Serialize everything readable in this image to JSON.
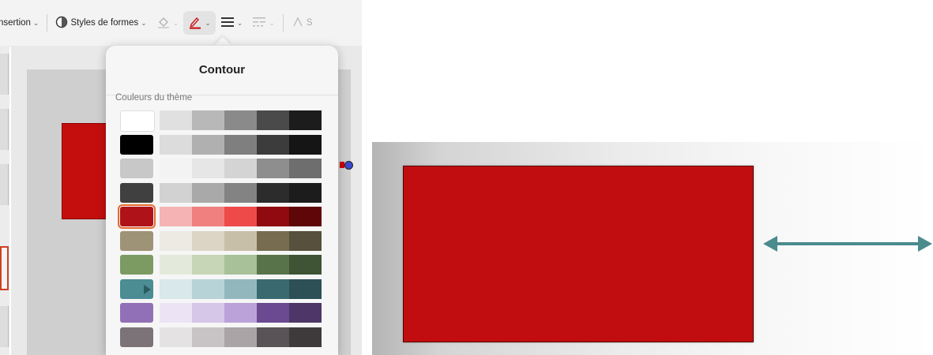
{
  "toolbar": {
    "insertion_label": "nsertion",
    "styles_label": "Styles de formes",
    "truncated_label": "S"
  },
  "popover": {
    "title": "Contour",
    "section_label": "Couleurs du thème",
    "selected_color": "#b0121a"
  },
  "theme_colors": [
    [
      "#ffffff",
      "#e0e0e0",
      "#b8b8b8",
      "#8a8a8a",
      "#4a4a4a",
      "#1c1c1c"
    ],
    [
      "#000000",
      "#dcdcdc",
      "#b0b0b0",
      "#7f7f7f",
      "#3c3c3c",
      "#151515"
    ],
    [
      "#c8c8c8",
      "#f3f3f3",
      "#e6e6e6",
      "#d4d4d4",
      "#8e8e8e",
      "#6e6e6e"
    ],
    [
      "#404040",
      "#d2d2d2",
      "#a9a9a9",
      "#838383",
      "#2c2c2c",
      "#1c1c1c"
    ],
    [
      "#b0121a",
      "#f6b3b3",
      "#f08080",
      "#ef4a4a",
      "#900a0f",
      "#5e0608"
    ],
    [
      "#9e9376",
      "#edeae4",
      "#dcd5c6",
      "#c8bfa8",
      "#786c50",
      "#56503c"
    ],
    [
      "#7b9b63",
      "#e3eadc",
      "#c6d6b7",
      "#a8c198",
      "#58734a",
      "#3e5434"
    ],
    [
      "#4c8c93",
      "#d9e8ea",
      "#b7d3d7",
      "#92b8bd",
      "#3a6a70",
      "#2c5055"
    ],
    [
      "#9270b7",
      "#ece4f4",
      "#d6c6e8",
      "#bba3d9",
      "#6c4a91",
      "#4e3668"
    ],
    [
      "#7c7378",
      "#e4e2e3",
      "#c8c4c6",
      "#aaa4a7",
      "#595256",
      "#3e3a3c"
    ]
  ],
  "arrow_color": "#4a8b8e",
  "shape_fill": "#c10d0f",
  "icons": [
    "chevron-down-icon",
    "shape-styles-icon",
    "fill-bucket-icon",
    "pen-outline-icon",
    "line-weight-icon",
    "dash-style-icon",
    "text-effect-icon",
    "double-arrow-icon"
  ]
}
